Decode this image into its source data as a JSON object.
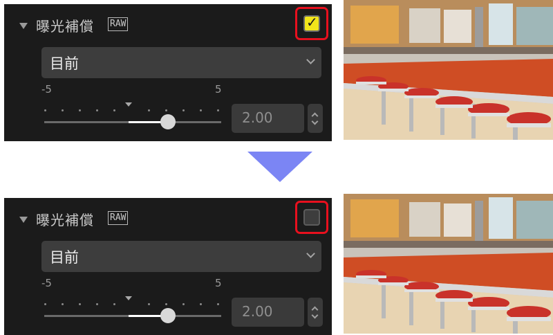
{
  "section": {
    "title": "曝光補償",
    "raw_badge": "RAW"
  },
  "states": [
    {
      "checkbox_checked": true,
      "checkbox_mark": "✓",
      "dropdown_value": "目前",
      "slider_min": "-5",
      "slider_max": "5",
      "value": "2.00",
      "slider_fraction": 0.7
    },
    {
      "checkbox_checked": false,
      "checkbox_mark": "",
      "dropdown_value": "目前",
      "slider_min": "-5",
      "slider_max": "5",
      "value": "2.00",
      "slider_fraction": 0.7
    }
  ],
  "colors": {
    "panel_bg": "#1b1b1b",
    "highlight": "#e8101e",
    "checkbox_on": "#f2e51a",
    "arrow": "#7b85f4"
  },
  "icons": {
    "expand": "triangle-down-icon",
    "check": "checkmark-icon",
    "dropdown": "chevron-down-icon",
    "spinner": "up-down-arrows-icon",
    "transition": "down-arrow-icon"
  }
}
